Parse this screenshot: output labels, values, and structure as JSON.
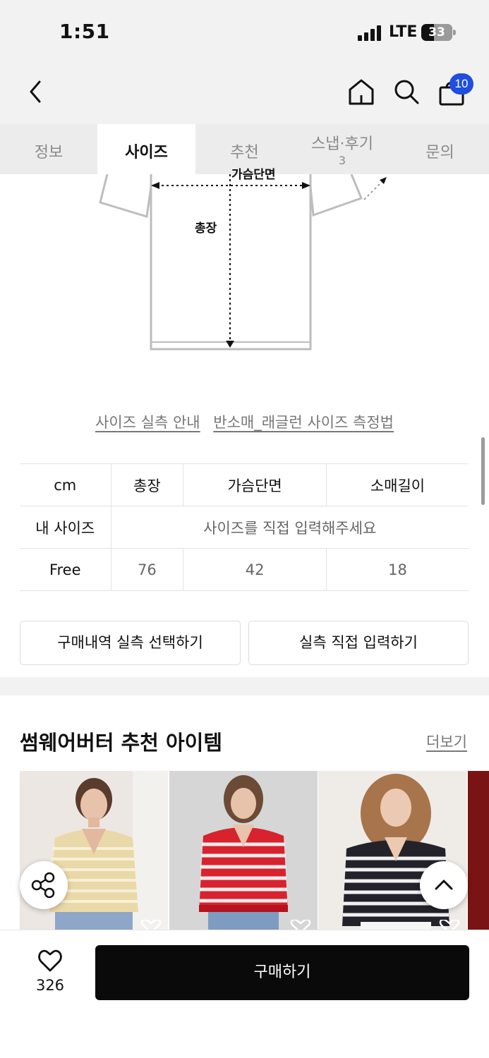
{
  "status_bar": {
    "time": "1:51",
    "network": "LTE",
    "battery": "33"
  },
  "header": {
    "cart_count": "10"
  },
  "tabs": [
    {
      "label": "정보"
    },
    {
      "label": "사이즈"
    },
    {
      "label": "추천"
    },
    {
      "label": "스냅·후기",
      "sub": "3"
    },
    {
      "label": "문의"
    }
  ],
  "diagram": {
    "chest_label": "가슴단면",
    "length_label": "총장"
  },
  "size_guide": {
    "link1": "사이즈 실측 안내",
    "link2": "반소매_래글런 사이즈 측정법"
  },
  "size_table": {
    "unit": "cm",
    "columns": [
      "총장",
      "가슴단면",
      "소매길이"
    ],
    "my_size_label": "내 사이즈",
    "my_size_placeholder": "사이즈를 직접 입력해주세요",
    "rows": [
      {
        "size": "Free",
        "values": [
          "76",
          "42",
          "18"
        ]
      }
    ]
  },
  "actions": {
    "select_history": "구매내역 실측 선택하기",
    "manual_input": "실측 직접 입력하기"
  },
  "recommend": {
    "title": "썸웨어버터 추천 아이템",
    "more": "더보기"
  },
  "bottom": {
    "likes": "326",
    "buy": "구매하기"
  },
  "colors": {
    "accent": "#1f4ee0",
    "buy_button": "#0a0a0a",
    "tab_bg": "#ececec"
  }
}
